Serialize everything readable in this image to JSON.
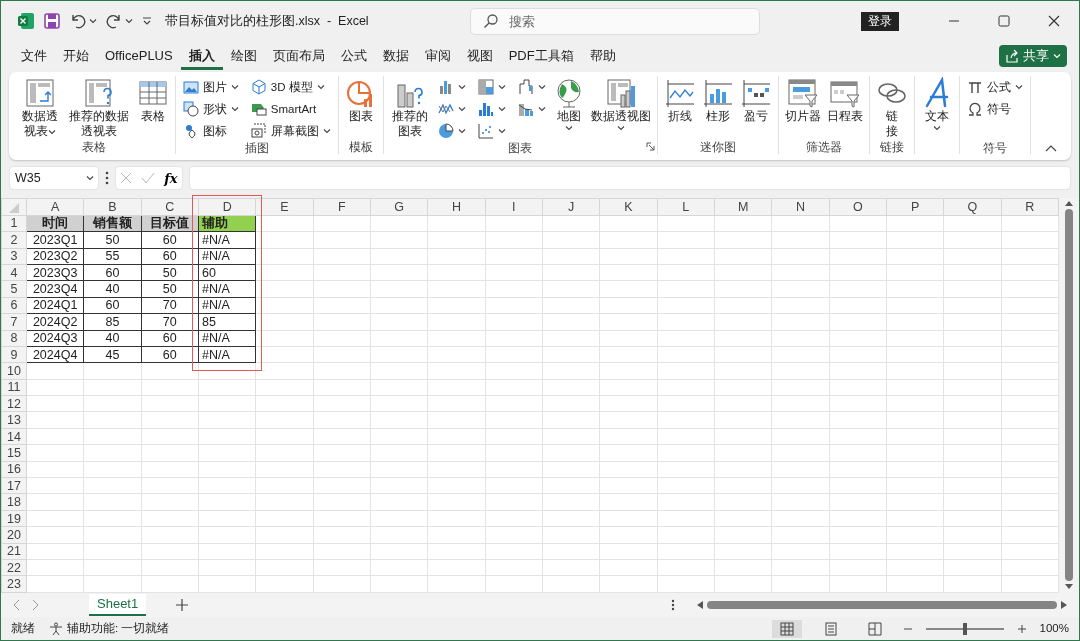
{
  "window": {
    "title": "带目标值对比的柱形图.xlsx  -  Excel",
    "search_placeholder": "搜索",
    "login": "登录"
  },
  "menu_tabs": [
    {
      "label": "文件",
      "selected": false
    },
    {
      "label": "开始",
      "selected": false
    },
    {
      "label": "OfficePLUS",
      "selected": false
    },
    {
      "label": "插入",
      "selected": true
    },
    {
      "label": "绘图",
      "selected": false
    },
    {
      "label": "页面布局",
      "selected": false
    },
    {
      "label": "公式",
      "selected": false
    },
    {
      "label": "数据",
      "selected": false
    },
    {
      "label": "审阅",
      "selected": false
    },
    {
      "label": "视图",
      "selected": false
    },
    {
      "label": "PDF工具箱",
      "selected": false
    },
    {
      "label": "帮助",
      "selected": false
    }
  ],
  "share_button": "共享",
  "ribbon": {
    "groups": [
      {
        "label": "表格",
        "items": [
          {
            "kind": "large",
            "label": "数据透视表",
            "two_line": true,
            "dropdown": true
          },
          {
            "kind": "large",
            "label": "推荐的数据透视表",
            "two_line": true
          },
          {
            "kind": "large",
            "label": "表格"
          }
        ]
      },
      {
        "label": "插图",
        "items": [
          {
            "kind": "small",
            "label": "图片",
            "dropdown": true
          },
          {
            "kind": "small",
            "label": "形状",
            "dropdown": true
          },
          {
            "kind": "small",
            "label": "图标"
          },
          {
            "kind": "small",
            "label": "3D 模型",
            "dropdown": true
          },
          {
            "kind": "small",
            "label": "SmartArt"
          },
          {
            "kind": "small",
            "label": "屏幕截图",
            "dropdown": true
          }
        ]
      },
      {
        "label": "模板",
        "items": [
          {
            "kind": "large",
            "label": "图表"
          }
        ]
      },
      {
        "label": "图表",
        "launcher": true,
        "items": [
          {
            "kind": "large",
            "label": "推荐的图表",
            "two_line": true
          },
          {
            "kind": "icon",
            "dropdown": true
          },
          {
            "kind": "icon",
            "dropdown": true
          },
          {
            "kind": "icon",
            "dropdown": true
          },
          {
            "kind": "icon",
            "dropdown": true
          },
          {
            "kind": "icon",
            "dropdown": true
          },
          {
            "kind": "icon",
            "dropdown": true
          },
          {
            "kind": "icon",
            "dropdown": true
          },
          {
            "kind": "icon",
            "dropdown": true
          },
          {
            "kind": "large",
            "label": "地图",
            "dropdown": true
          },
          {
            "kind": "large",
            "label": "数据透视图",
            "dropdown": true
          }
        ]
      },
      {
        "label": "迷你图",
        "items": [
          {
            "kind": "large",
            "label": "折线"
          },
          {
            "kind": "large",
            "label": "柱形"
          },
          {
            "kind": "large",
            "label": "盈亏"
          }
        ]
      },
      {
        "label": "筛选器",
        "items": [
          {
            "kind": "large",
            "label": "切片器"
          },
          {
            "kind": "large",
            "label": "日程表"
          }
        ]
      },
      {
        "label": "链接",
        "items": [
          {
            "kind": "large",
            "label": "链接",
            "two_line": true
          }
        ]
      },
      {
        "items": [
          {
            "kind": "large",
            "label": "文本",
            "dropdown": true
          }
        ]
      },
      {
        "label": "符号",
        "items": [
          {
            "kind": "small",
            "label": "公式",
            "dropdown": true
          },
          {
            "kind": "small",
            "label": "符号"
          }
        ]
      }
    ]
  },
  "formula_bar": {
    "name_box": "W35",
    "insert_function": "fx"
  },
  "column_headers": [
    {
      "label": "A",
      "framed": false
    },
    {
      "label": "B",
      "framed": false
    },
    {
      "label": "C",
      "framed": false
    },
    {
      "label": "D",
      "framed": true
    },
    {
      "label": "E",
      "framed": false
    },
    {
      "label": "F",
      "framed": false
    },
    {
      "label": "G",
      "framed": false
    },
    {
      "label": "H",
      "framed": false
    },
    {
      "label": "I",
      "framed": false
    },
    {
      "label": "J",
      "framed": false
    },
    {
      "label": "K",
      "framed": false
    },
    {
      "label": "L",
      "framed": false
    },
    {
      "label": "M",
      "framed": false
    },
    {
      "label": "N",
      "framed": false
    },
    {
      "label": "O",
      "framed": false
    },
    {
      "label": "P",
      "framed": false
    },
    {
      "label": "Q",
      "framed": false
    },
    {
      "label": "R",
      "framed": false
    }
  ],
  "row_headers": [
    "1",
    "2",
    "3",
    "4",
    "5",
    "6",
    "7",
    "8",
    "9",
    "10",
    "11",
    "12",
    "13",
    "14",
    "15",
    "16",
    "17",
    "18",
    "19",
    "20",
    "21",
    "22",
    "23"
  ],
  "data_table": {
    "header": [
      {
        "text": "时间",
        "color": "#d0d0d0",
        "centered": true
      },
      {
        "text": "销售额",
        "color": "#d0d0d0",
        "centered": true
      },
      {
        "text": "目标值",
        "color": "#d0d0d0",
        "centered": true
      },
      {
        "text": "辅助",
        "color": "#92d050",
        "centered": false
      }
    ],
    "rows": [
      [
        "2023Q1",
        "50",
        "60",
        "#N/A"
      ],
      [
        "2023Q2",
        "55",
        "60",
        "#N/A"
      ],
      [
        "2023Q3",
        "60",
        "50",
        "60"
      ],
      [
        "2023Q4",
        "40",
        "50",
        "#N/A"
      ],
      [
        "2024Q1",
        "60",
        "70",
        "#N/A"
      ],
      [
        "2024Q2",
        "85",
        "70",
        "85"
      ],
      [
        "2024Q3",
        "40",
        "60",
        "#N/A"
      ],
      [
        "2024Q4",
        "45",
        "60",
        "#N/A"
      ]
    ]
  },
  "sheet_tabs": [
    {
      "label": "Sheet1",
      "selected": true
    }
  ],
  "status_bar": {
    "ready": "就绪",
    "accessibility": "辅助功能: 一切就绪",
    "views": [
      {
        "kind": "normal",
        "selected": true
      },
      {
        "kind": "page_layout",
        "selected": false
      },
      {
        "kind": "page_break",
        "selected": false
      }
    ],
    "zoom": {
      "level": 0.5
    },
    "zoom_percent": "100%"
  }
}
